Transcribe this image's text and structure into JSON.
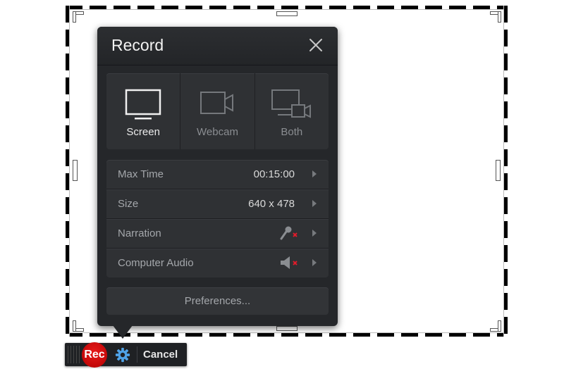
{
  "panel": {
    "title": "Record",
    "close_icon": "close-icon",
    "modes": [
      {
        "label": "Screen",
        "icon": "monitor-icon",
        "active": true
      },
      {
        "label": "Webcam",
        "icon": "webcam-icon",
        "active": false
      },
      {
        "label": "Both",
        "icon": "monitor-webcam-icon",
        "active": false
      }
    ],
    "settings": [
      {
        "label": "Max Time",
        "value": "00:15:00"
      },
      {
        "label": "Size",
        "value": "640 x 478"
      },
      {
        "label": "Narration",
        "value": "",
        "status_icon": "microphone-off-icon"
      },
      {
        "label": "Computer Audio",
        "value": "",
        "status_icon": "speaker-muted-icon"
      }
    ],
    "preferences_label": "Preferences..."
  },
  "toolbar": {
    "rec_label": "Rec",
    "settings_icon": "gear-icon",
    "cancel_label": "Cancel"
  },
  "colors": {
    "panel_bg": "#25272a",
    "rec_red": "#d40d0d",
    "gear_blue": "#4fa3e8",
    "muted_red": "#e01b2a"
  }
}
